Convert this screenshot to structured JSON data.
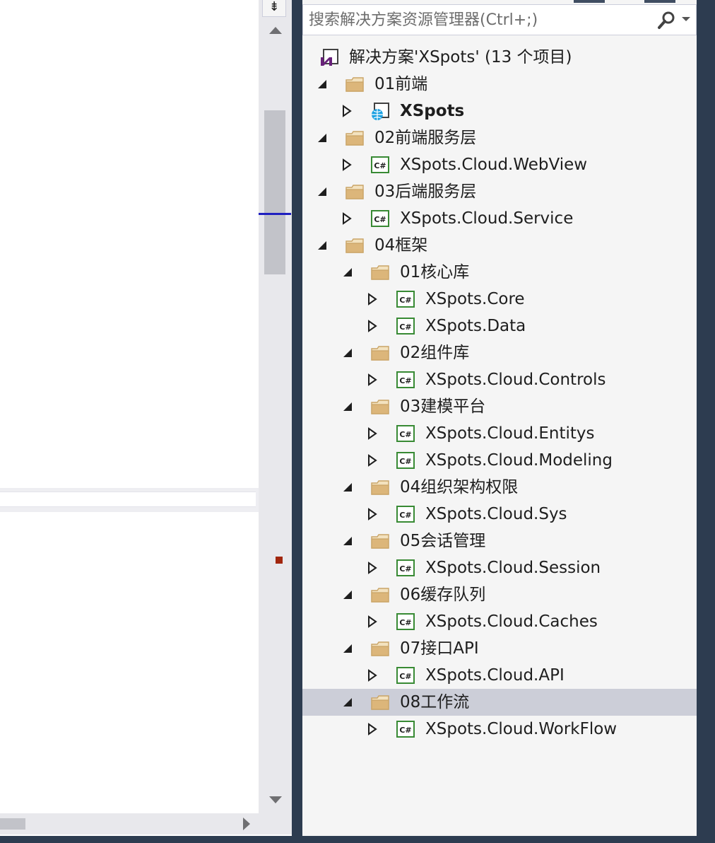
{
  "search": {
    "placeholder": "搜索解决方案资源管理器(Ctrl+;)",
    "icon": "search-icon"
  },
  "colors": {
    "frame": "#2d3c50",
    "selection": "#ccced8",
    "folder": "#dcb67a",
    "csharp": "#388a34",
    "solution": "#68217a",
    "web": "#1ba1e2"
  },
  "tree": {
    "solution": {
      "label": "解决方案'XSpots' (13 个项目)"
    },
    "folder_01": {
      "label": "01前端"
    },
    "proj_xspots": {
      "label": "XSpots"
    },
    "folder_02": {
      "label": "02前端服务层"
    },
    "proj_webview": {
      "label": "XSpots.Cloud.WebView"
    },
    "folder_03": {
      "label": "03后端服务层"
    },
    "proj_service": {
      "label": "XSpots.Cloud.Service"
    },
    "folder_04": {
      "label": "04框架"
    },
    "sub_01": {
      "label": "01核心库"
    },
    "proj_core": {
      "label": "XSpots.Core"
    },
    "proj_data": {
      "label": "XSpots.Data"
    },
    "sub_02": {
      "label": "02组件库"
    },
    "proj_controls": {
      "label": "XSpots.Cloud.Controls"
    },
    "sub_03": {
      "label": "03建模平台"
    },
    "proj_entitys": {
      "label": "XSpots.Cloud.Entitys"
    },
    "proj_modeling": {
      "label": "XSpots.Cloud.Modeling"
    },
    "sub_04": {
      "label": "04组织架构权限"
    },
    "proj_sys": {
      "label": "XSpots.Cloud.Sys"
    },
    "sub_05": {
      "label": "05会话管理"
    },
    "proj_session": {
      "label": "XSpots.Cloud.Session"
    },
    "sub_06": {
      "label": "06缓存队列"
    },
    "proj_caches": {
      "label": "XSpots.Cloud.Caches"
    },
    "sub_07": {
      "label": "07接口API"
    },
    "proj_api": {
      "label": "XSpots.Cloud.API"
    },
    "sub_08": {
      "label": "08工作流"
    },
    "proj_workflow": {
      "label": "XSpots.Cloud.WorkFlow"
    }
  },
  "editor": {
    "split_glyph": "⇟"
  }
}
